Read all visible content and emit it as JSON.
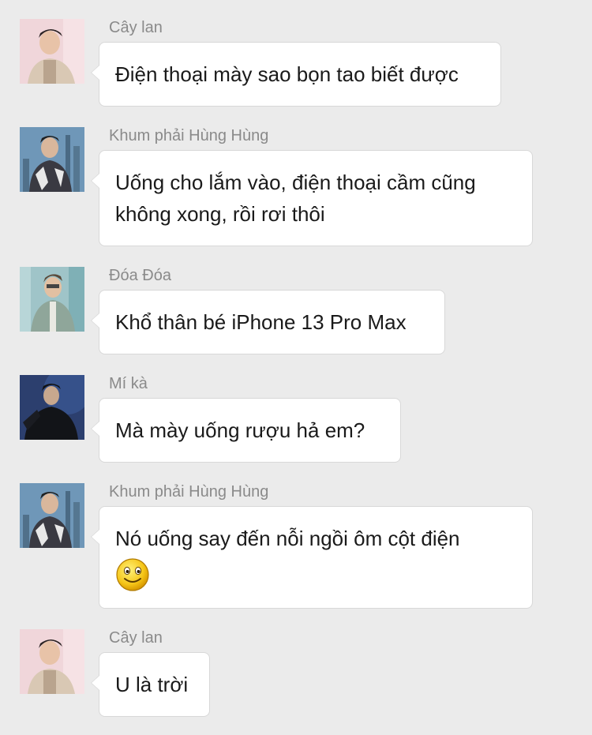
{
  "chat": {
    "messages": [
      {
        "sender": "Cây lan",
        "avatar": "avatar-photo-pink",
        "lines": [
          "Điện thoại mày sao bọn tao biết được"
        ]
      },
      {
        "sender": "Khum phải Hùng Hùng",
        "avatar": "avatar-photo-city",
        "lines": [
          "Uống cho lắm vào, điện thoại cầm cũng",
          "không xong, rồi rơi thôi"
        ]
      },
      {
        "sender": "Đóa Đóa",
        "avatar": "avatar-photo-teal",
        "lines": [
          "Khổ thân bé iPhone 13 Pro Max"
        ]
      },
      {
        "sender": "Mí kà",
        "avatar": "avatar-photo-dark-blue",
        "lines": [
          "Mà mày uống rượu hả em?"
        ]
      },
      {
        "sender": "Khum phải Hùng Hùng",
        "avatar": "avatar-photo-city",
        "lines": [
          "Nó uống say đến nỗi ngồi ôm cột điện"
        ],
        "emoji": "smiley-icon"
      },
      {
        "sender": "Cây lan",
        "avatar": "avatar-photo-pink",
        "lines": [
          "U là trời"
        ]
      }
    ]
  },
  "colors": {
    "background": "#ebebeb",
    "bubble": "#ffffff",
    "sender_text": "#8a8a8a",
    "message_text": "#1a1a1a"
  }
}
